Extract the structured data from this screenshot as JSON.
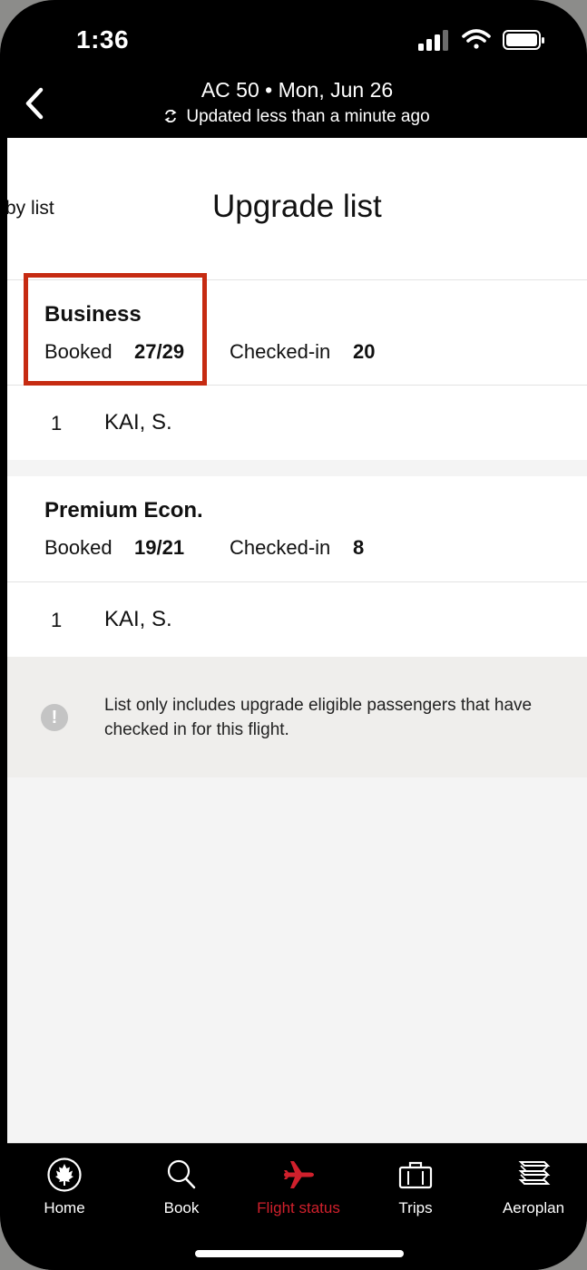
{
  "status_bar": {
    "time": "1:36"
  },
  "header": {
    "title": "AC 50 • Mon, Jun 26",
    "subtitle": "Updated less than a minute ago"
  },
  "page": {
    "previous_title": "by list",
    "title": "Upgrade list"
  },
  "cabins": [
    {
      "name": "Business",
      "booked_label": "Booked",
      "booked_value": "27/29",
      "checked_label": "Checked-in",
      "checked_value": "20",
      "passengers": [
        {
          "position": "1",
          "name": "KAI, S."
        }
      ]
    },
    {
      "name": "Premium Econ.",
      "booked_label": "Booked",
      "booked_value": "19/21",
      "checked_label": "Checked-in",
      "checked_value": "8",
      "passengers": [
        {
          "position": "1",
          "name": "KAI, S."
        }
      ]
    }
  ],
  "notice": {
    "icon": "exclamation-icon",
    "text": "List only includes upgrade eligible passengers that have checked in for this flight."
  },
  "tabs": [
    {
      "label": "Home",
      "icon": "maple-leaf-icon",
      "active": false
    },
    {
      "label": "Book",
      "icon": "search-icon",
      "active": false
    },
    {
      "label": "Flight status",
      "icon": "airplane-icon",
      "active": true
    },
    {
      "label": "Trips",
      "icon": "suitcase-icon",
      "active": false
    },
    {
      "label": "Aeroplan",
      "icon": "aeroplan-icon",
      "active": false
    }
  ],
  "colors": {
    "active_tab": "#d0202c",
    "highlight_box": "#c62b12",
    "header_bg": "#000000"
  }
}
